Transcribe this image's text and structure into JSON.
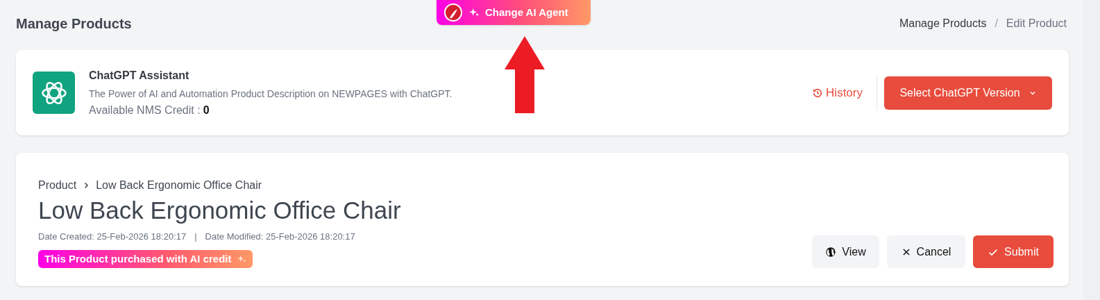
{
  "page_title": "Manage Products",
  "agent_button": {
    "label": "Change AI Agent"
  },
  "breadcrumb_separator": "/",
  "breadcrumb": [
    {
      "label": "Manage Products",
      "selected": false
    },
    {
      "label": "Edit Product",
      "selected": true
    }
  ],
  "assistant": {
    "name": "ChatGPT Assistant",
    "description": "The Power of AI and Automation Product Description on NEWPAGES with ChatGPT.",
    "credit_label": "Available NMS Credit :",
    "credit_value": "0",
    "history_label": "History",
    "version_button": "Select ChatGPT Version"
  },
  "product": {
    "path": [
      "Product",
      "Low Back Ergonomic Office Chair"
    ],
    "title": "Low Back Ergonomic Office Chair",
    "date_created": "Date Created: 25-Feb-2026 18:20:17",
    "separator": "|",
    "date_modified": "Date Modified: 25-Feb-2026 18:20:17",
    "badge": "This Product purchased with AI credit"
  },
  "actions": [
    {
      "kind": "view",
      "label": "View"
    },
    {
      "kind": "cancel",
      "label": "Cancel"
    },
    {
      "kind": "submit",
      "label": "Submit"
    }
  ]
}
